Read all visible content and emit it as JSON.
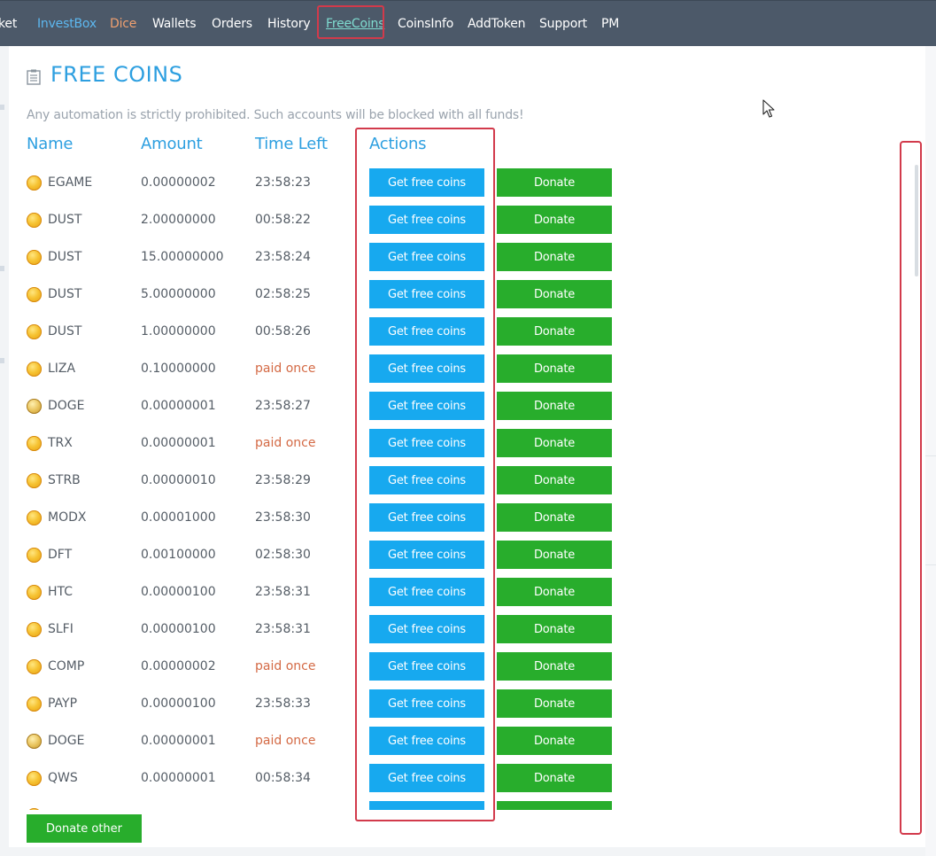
{
  "nav": {
    "items": [
      {
        "label": "ket",
        "style": "normal"
      },
      {
        "label": "InvestBox",
        "style": "blue"
      },
      {
        "label": "Dice",
        "style": "orange"
      },
      {
        "label": "Wallets",
        "style": "normal"
      },
      {
        "label": "Orders",
        "style": "normal"
      },
      {
        "label": "History",
        "style": "normal"
      },
      {
        "label": "FreeCoins",
        "style": "active"
      },
      {
        "label": "CoinsInfo",
        "style": "normal"
      },
      {
        "label": "AddToken",
        "style": "normal"
      },
      {
        "label": "Support",
        "style": "normal"
      },
      {
        "label": "PM",
        "style": "normal"
      }
    ]
  },
  "page": {
    "title": "FREE COINS",
    "title_icon": "clipboard-icon",
    "notice": "Any automation is strictly prohibited. Such accounts will be blocked with all funds!"
  },
  "table": {
    "headers": {
      "name": "Name",
      "amount": "Amount",
      "time": "Time Left",
      "actions": "Actions"
    },
    "get_label": "Get free coins",
    "donate_label": "Donate",
    "rows": [
      {
        "coin": "EGAME",
        "amount": "0.00000002",
        "time": "23:58:23",
        "paid": false,
        "icon": "coin-icon"
      },
      {
        "coin": "DUST",
        "amount": "2.00000000",
        "time": "00:58:22",
        "paid": false,
        "icon": "coin-icon"
      },
      {
        "coin": "DUST",
        "amount": "15.00000000",
        "time": "23:58:24",
        "paid": false,
        "icon": "coin-icon"
      },
      {
        "coin": "DUST",
        "amount": "5.00000000",
        "time": "02:58:25",
        "paid": false,
        "icon": "coin-icon"
      },
      {
        "coin": "DUST",
        "amount": "1.00000000",
        "time": "00:58:26",
        "paid": false,
        "icon": "coin-icon"
      },
      {
        "coin": "LIZA",
        "amount": "0.10000000",
        "time": "paid once",
        "paid": true,
        "icon": "coin-icon"
      },
      {
        "coin": "DOGE",
        "amount": "0.00000001",
        "time": "23:58:27",
        "paid": false,
        "icon": "doge-coin-icon"
      },
      {
        "coin": "TRX",
        "amount": "0.00000001",
        "time": "paid once",
        "paid": true,
        "icon": "coin-icon"
      },
      {
        "coin": "STRB",
        "amount": "0.00000010",
        "time": "23:58:29",
        "paid": false,
        "icon": "coin-icon"
      },
      {
        "coin": "MODX",
        "amount": "0.00001000",
        "time": "23:58:30",
        "paid": false,
        "icon": "coin-icon"
      },
      {
        "coin": "DFT",
        "amount": "0.00100000",
        "time": "02:58:30",
        "paid": false,
        "icon": "coin-icon"
      },
      {
        "coin": "HTC",
        "amount": "0.00000100",
        "time": "23:58:31",
        "paid": false,
        "icon": "coin-icon"
      },
      {
        "coin": "SLFI",
        "amount": "0.00000100",
        "time": "23:58:31",
        "paid": false,
        "icon": "coin-icon"
      },
      {
        "coin": "COMP",
        "amount": "0.00000002",
        "time": "paid once",
        "paid": true,
        "icon": "coin-icon"
      },
      {
        "coin": "PAYP",
        "amount": "0.00000100",
        "time": "23:58:33",
        "paid": false,
        "icon": "coin-icon"
      },
      {
        "coin": "DOGE",
        "amount": "0.00000001",
        "time": "paid once",
        "paid": true,
        "icon": "doge-coin-icon"
      },
      {
        "coin": "QWS",
        "amount": "0.00000001",
        "time": "00:58:34",
        "paid": false,
        "icon": "coin-icon"
      },
      {
        "coin": "",
        "amount": "",
        "time": "",
        "paid": false,
        "icon": "coin-icon"
      }
    ]
  },
  "footer": {
    "donate_other_label": "Donate other"
  },
  "colors": {
    "nav_bg": "#4c5969",
    "accent_blue": "#2d9fe0",
    "get_button": "#17a9ef",
    "donate_button": "#28ad2c",
    "paid_text": "#d46a45",
    "highlight": "#d23a4b"
  }
}
